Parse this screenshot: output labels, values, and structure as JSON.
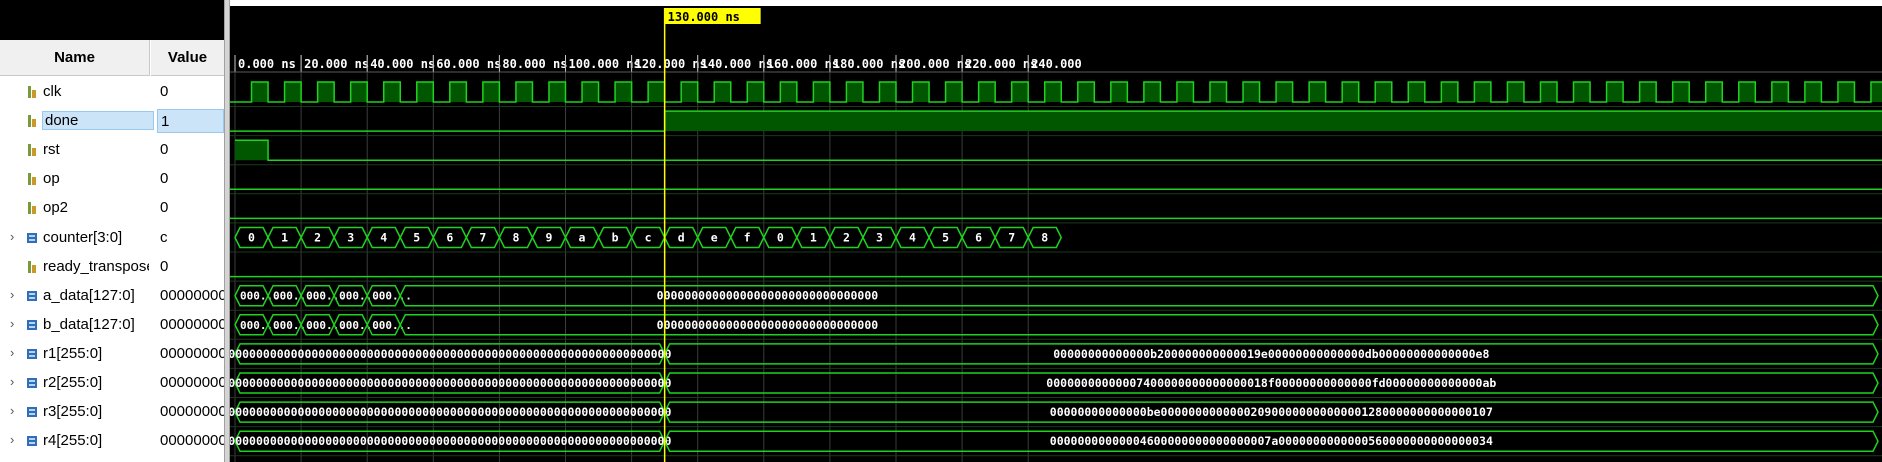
{
  "columns": {
    "name": "Name",
    "value": "Value"
  },
  "signals": [
    {
      "name": "clk",
      "value": "0",
      "kind": "bit",
      "expandable": false
    },
    {
      "name": "done",
      "value": "1",
      "kind": "bit",
      "expandable": false,
      "selected": true
    },
    {
      "name": "rst",
      "value": "0",
      "kind": "bit",
      "expandable": false
    },
    {
      "name": "op",
      "value": "0",
      "kind": "bit",
      "expandable": false
    },
    {
      "name": "op2",
      "value": "0",
      "kind": "bit",
      "expandable": false
    },
    {
      "name": "counter[3:0]",
      "value": "c",
      "kind": "bus",
      "expandable": true
    },
    {
      "name": "ready_transpose",
      "value": "0",
      "kind": "bit",
      "expandable": false
    },
    {
      "name": "a_data[127:0]",
      "value": "00000000",
      "kind": "bus",
      "expandable": true
    },
    {
      "name": "b_data[127:0]",
      "value": "00000000",
      "kind": "bus",
      "expandable": true
    },
    {
      "name": "r1[255:0]",
      "value": "00000000",
      "kind": "bus",
      "expandable": true
    },
    {
      "name": "r2[255:0]",
      "value": "00000000",
      "kind": "bus",
      "expandable": true
    },
    {
      "name": "r3[255:0]",
      "value": "00000000",
      "kind": "bus",
      "expandable": true
    },
    {
      "name": "r4[255:0]",
      "value": "00000000",
      "kind": "bus",
      "expandable": true
    }
  ],
  "timeline": {
    "ticks": [
      "0.000 ns",
      "20.000 ns",
      "40.000 ns",
      "60.000 ns",
      "80.000 ns",
      "100.000 ns",
      "120.000 ns",
      "140.000 ns",
      "160.000 ns",
      "180.000 ns",
      "200.000 ns",
      "220.000 ns",
      "240.000"
    ],
    "cursor_label": "130.000 ns",
    "cursor_time_ns": 130,
    "start_ns": 0,
    "tick_step_ns": 20
  },
  "waves": {
    "clk": {
      "period_ns": 10,
      "first_rise_ns": 5
    },
    "done": {
      "rise_ns": 130
    },
    "rst": {
      "high_until_ns": 10
    },
    "counter_values": [
      "0",
      "1",
      "2",
      "3",
      "4",
      "5",
      "6",
      "7",
      "8",
      "9",
      "a",
      "b",
      "c",
      "d",
      "e",
      "f",
      "0",
      "1",
      "2",
      "3",
      "4",
      "5",
      "6",
      "7",
      "8"
    ],
    "a_data": {
      "early_label": "000...",
      "early_segments": 5,
      "value": "00000000000000000000000000000000"
    },
    "b_data": {
      "early_label": "000...",
      "early_segments": 5,
      "value": "00000000000000000000000000000000"
    },
    "r_before": "0000000000000000000000000000000000000000000000000000000000000000",
    "r1_after": "00000000000000b200000000000019e00000000000000db00000000000000e8",
    "r2_after": "00000000000007400000000000000018f00000000000000fd00000000000000ab",
    "r3_after": "00000000000000be000000000000020900000000000001280000000000000107",
    "r4_after": "00000000000004600000000000000007a0000000000000560000000000000034"
  },
  "colors": {
    "background": "#000000",
    "wave": "#1fd21f",
    "wave_fill": "#005700",
    "grid": "#3c3c3c",
    "cursor": "#ffff00",
    "text": "#ffffff"
  }
}
